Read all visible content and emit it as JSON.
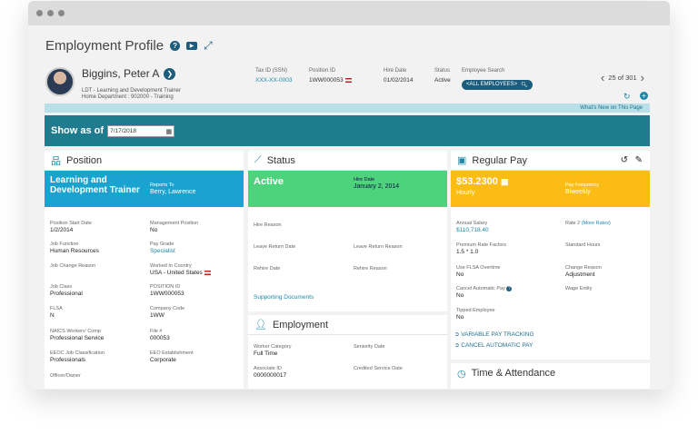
{
  "page": {
    "title": "Employment Profile"
  },
  "employee": {
    "name": "Biggins, Peter A",
    "job": "LDT - Learning and Development Trainer",
    "department": "Home Department : 902000 - Training"
  },
  "header_fields": {
    "tax_id": {
      "label": "Tax ID (SSN)",
      "value": "XXX-XX-0003"
    },
    "position_id": {
      "label": "Position ID",
      "value": "1WW000053"
    },
    "hire_date": {
      "label": "Hire Date",
      "value": "01/02/2014"
    },
    "status": {
      "label": "Status",
      "value": "Active"
    },
    "employee_search": {
      "label": "Employee Search",
      "value": "<ALL EMPLOYEES>"
    }
  },
  "pager": {
    "text": "25 of 301"
  },
  "whats_new": "What's New on This Page",
  "show_as_of": {
    "label": "Show as of",
    "value": "7/17/2018"
  },
  "position": {
    "title": "Position",
    "job_title": "Learning and Development Trainer",
    "reports_to_label": "Reports To",
    "reports_to": "Berry, Lawrence",
    "fields": {
      "start_date": {
        "label": "Position Start Date",
        "value": "1/2/2014"
      },
      "mgmt_position": {
        "label": "Management Position",
        "value": "No"
      },
      "job_function": {
        "label": "Job Function",
        "value": "Human Resources"
      },
      "pay_grade": {
        "label": "Pay Grade",
        "value": "Specialist"
      },
      "job_change_reason": {
        "label": "Job Change Reason",
        "value": ""
      },
      "worked_in_country": {
        "label": "Worked In Country",
        "value": "USA - United States"
      },
      "job_class": {
        "label": "Job Class",
        "value": "Professional"
      },
      "position_id": {
        "label": "POSITION ID",
        "value": "1WW000053"
      },
      "flsa": {
        "label": "FLSA",
        "value": "N"
      },
      "company_code": {
        "label": "Company Code",
        "value": "1WW"
      },
      "naics": {
        "label": "NAICS Workers' Comp",
        "value": "Professional Service"
      },
      "file_no": {
        "label": "File #",
        "value": "000053"
      },
      "eeoc": {
        "label": "EEOC Job Classification",
        "value": "Professionals"
      },
      "eeo_est": {
        "label": "EEO Establishment",
        "value": "Corporate"
      },
      "officer": {
        "label": "Officer/Owner",
        "value": ""
      }
    }
  },
  "status": {
    "title": "Status",
    "state": "Active",
    "hire_date_label": "Hire Date",
    "hire_date": "January 2, 2014",
    "fields": {
      "hire_reason": {
        "label": "Hire Reason"
      },
      "leave_return_date": {
        "label": "Leave Return Date"
      },
      "leave_return_reason": {
        "label": "Leave Return Reason"
      },
      "rehire_date": {
        "label": "Rehire Date"
      },
      "rehire_reason": {
        "label": "Rehire Reason"
      }
    },
    "supporting_docs": "Supporting Documents"
  },
  "employment": {
    "title": "Employment",
    "fields": {
      "worker_category": {
        "label": "Worker Category",
        "value": "Full Time"
      },
      "seniority_date": {
        "label": "Seniority Date",
        "value": ""
      },
      "associate_id": {
        "label": "Associate ID",
        "value": "0000000017"
      },
      "credited_service": {
        "label": "Credited Service Date",
        "value": ""
      }
    }
  },
  "regular_pay": {
    "title": "Regular Pay",
    "amount": "$53.2300",
    "unit": "Hourly",
    "frequency_label": "Pay Frequency",
    "frequency": "Biweekly",
    "fields": {
      "annual_salary": {
        "label": "Annual Salary",
        "value": "$110,718.40"
      },
      "rate2": {
        "label": "Rate 2",
        "more": "(More Rates)"
      },
      "premium_rate": {
        "label": "Premium Rate Factors",
        "value": "1.5 * 1.0"
      },
      "standard_hours": {
        "label": "Standard Hours",
        "value": ""
      },
      "use_flsa_ot": {
        "label": "Use FLSA Overtime",
        "value": "No"
      },
      "change_reason": {
        "label": "Change Reason",
        "value": "Adjustment"
      },
      "cancel_auto_pay": {
        "label": "Cancel Automatic Pay",
        "value": "No"
      },
      "wage_entity": {
        "label": "Wage Entity",
        "value": ""
      },
      "tipped": {
        "label": "Tipped Employee",
        "value": "No"
      }
    },
    "links": {
      "variable_pay": "VARIABLE PAY TRACKING",
      "cancel_auto": "CANCEL AUTOMATIC PAY"
    }
  },
  "time_attendance": {
    "title": "Time & Attendance"
  },
  "colors": {
    "teal": "#1f7c8f",
    "position_band": "#1ba3cf",
    "status_band": "#4cd37c",
    "pay_band": "#fbbd14",
    "link": "#1e88a8"
  }
}
